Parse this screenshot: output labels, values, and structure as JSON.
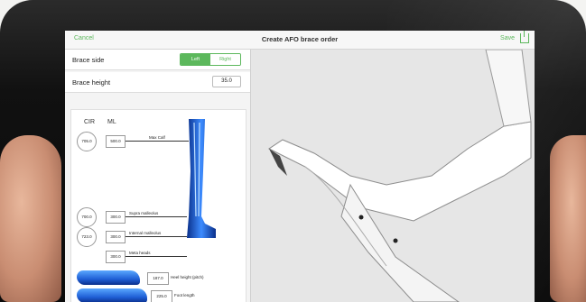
{
  "app": {
    "cancel_label": "Cancel",
    "title": "Create AFO brace order",
    "save_label": "Save"
  },
  "brace_side": {
    "label": "Brace side",
    "options": [
      "Left",
      "Right"
    ],
    "selected": "Left"
  },
  "brace_height": {
    "label": "Brace height",
    "value": "35.0"
  },
  "measurements": {
    "col_cir": "CIR",
    "col_ml": "ML",
    "items": [
      {
        "label": "Max Calf",
        "cir": "705.0",
        "ml": "500.0"
      },
      {
        "label": "Supra malleolus",
        "cir": "700.0",
        "ml": "300.0"
      },
      {
        "label": "Internal malleolus",
        "cir": "723.0",
        "ml": "300.0"
      },
      {
        "label": "Meta heads",
        "ml": "300.0"
      }
    ],
    "heel_height": {
      "label": "Heel height (pitch)",
      "value": "187.0"
    },
    "foot_length": {
      "label": "Foot length",
      "value": "225.0"
    }
  },
  "icons": [
    "share-icon"
  ],
  "colors": {
    "accent": "#5cb85c",
    "foot_scan": "#1f5fd6"
  }
}
